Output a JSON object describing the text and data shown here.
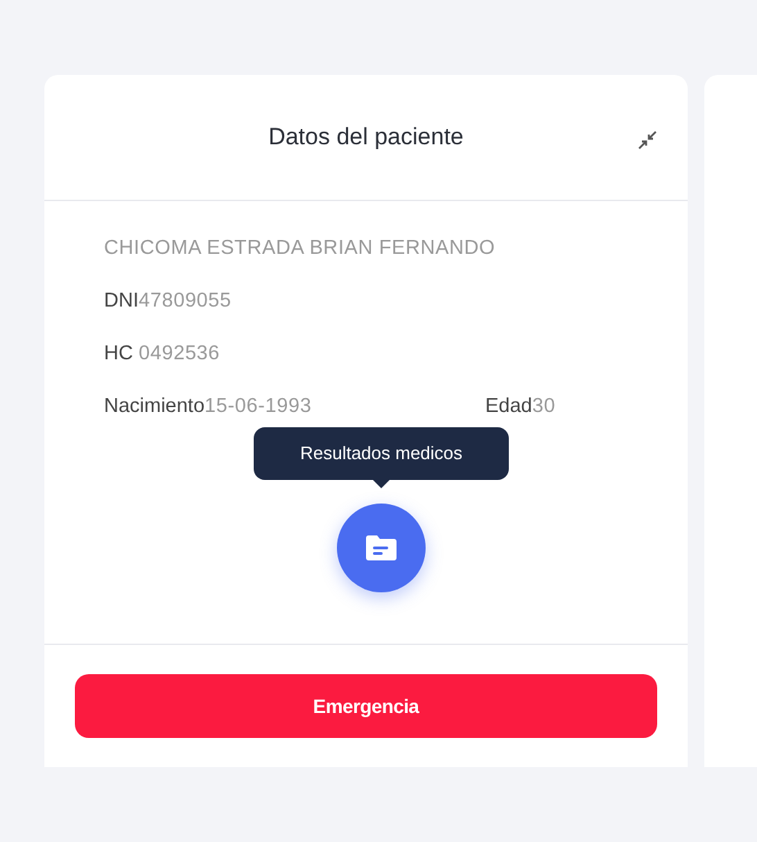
{
  "card": {
    "title": "Datos del paciente",
    "patient_name": "CHICOMA ESTRADA BRIAN FERNANDO",
    "fields": [
      {
        "label": "DNI",
        "value": "47809055"
      },
      {
        "label": "HC",
        "value": "0492536"
      }
    ],
    "birth": {
      "label": "Nacimiento",
      "value": "15-06-1993"
    },
    "age": {
      "label": "Edad",
      "value": "30"
    },
    "results_tooltip": "Resultados medicos",
    "emergency_button": "Emergencia"
  }
}
